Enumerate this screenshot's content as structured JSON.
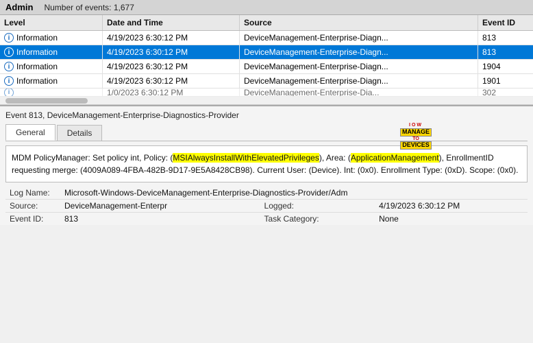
{
  "topbar": {
    "admin_label": "Admin",
    "events_label": "Number of events: 1,677"
  },
  "table": {
    "headers": [
      "Level",
      "Date and Time",
      "Source",
      "Event ID"
    ],
    "rows": [
      {
        "level": "Information",
        "datetime": "4/19/2023 6:30:12 PM",
        "source": "DeviceManagement-Enterprise-Diagn...",
        "event_id": "813",
        "selected": false
      },
      {
        "level": "Information",
        "datetime": "4/19/2023 6:30:12 PM",
        "source": "DeviceManagement-Enterprise-Diagn...",
        "event_id": "813",
        "selected": true
      },
      {
        "level": "Information",
        "datetime": "4/19/2023 6:30:12 PM",
        "source": "DeviceManagement-Enterprise-Diagn...",
        "event_id": "1904",
        "selected": false
      },
      {
        "level": "Information",
        "datetime": "4/19/2023 6:30:12 PM",
        "source": "DeviceManagement-Enterprise-Diagn...",
        "event_id": "1901",
        "selected": false
      }
    ],
    "partial_row": {
      "level": "i...",
      "datetime": "1/0/2023 6:30:12 PM",
      "source": "DeviceManagement-Enterprise-Dia...",
      "event_id": "302"
    }
  },
  "detail": {
    "event_title": "Event 813, DeviceManagement-Enterprise-Diagnostics-Provider",
    "tabs": [
      "General",
      "Details"
    ],
    "active_tab": "General",
    "content": {
      "text_before_policy": "MDM PolicyManager: Set policy int, Policy: (",
      "policy_highlight": "MSIAlwaysInstallWithElevatedPrivileges",
      "text_after_policy": "), Area: (",
      "area_highlight": "ApplicationManagement",
      "text_rest": "), EnrollmentID requesting merge: (4009A089-4FBA-482B-9D17-9E5A8428CB98). Current User: (Device). Int: (0x0). Enrollment Type: (0xD). Scope: (0x0)."
    },
    "meta": {
      "log_name_label": "Log Name:",
      "log_name_value": "Microsoft-Windows-DeviceManagement-Enterprise-Diagnostics-Provider/Adm",
      "source_label": "Source:",
      "source_value": "DeviceManagement-Enterpr",
      "logged_label": "Logged:",
      "logged_value": "4/19/2023 6:30:12 PM",
      "event_id_label": "Event ID:",
      "event_id_value": "813",
      "task_category_label": "Task Category:",
      "task_category_value": "None"
    }
  },
  "watermark": {
    "iow": "IOW",
    "to": "TO",
    "manage": "MANAGE",
    "devices": "DEVICES"
  }
}
